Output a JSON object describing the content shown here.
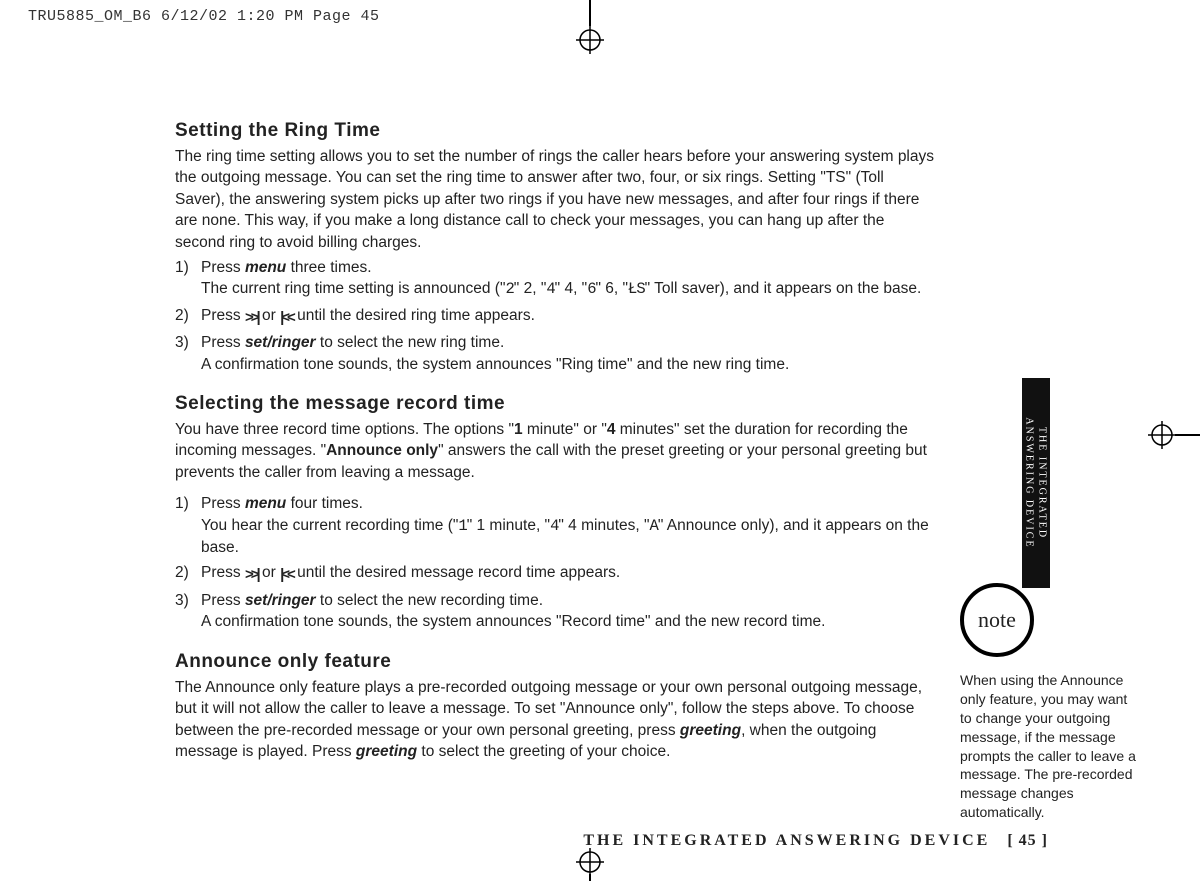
{
  "print_header": "TRU5885_OM_B6  6/12/02  1:20 PM  Page 45",
  "side_tab": "THE INTEGRATED\nANSWERING DEVICE",
  "footer_title": "THE INTEGRATED ANSWERING DEVICE",
  "footer_page": "[ 45 ]",
  "note_label": "note",
  "note_text": "When using the Announce only feature, you may want to change your outgoing message, if the message prompts the caller to leave a message. The pre-recorded message changes automatically.",
  "sections": {
    "ring": {
      "title": "Setting the Ring Time",
      "intro": "The ring time setting allows you to set the number of rings the caller hears before your answering system plays the outgoing message. You can set the ring time to answer after two, four, or six rings. Setting \"TS\" (Toll Saver), the answering system picks up after two rings if you have new messages, and after four rings if there are none. This way, if you make a long distance call to check your messages, you can hang up after the second ring to avoid billing charges.",
      "s1a": "Press ",
      "s1b": " three times.",
      "s1c_pre": "The current ring time setting is announced (\"",
      "s1c_v2": "\" 2, \"",
      "s1c_v4": "\" 4, \"",
      "s1c_v6": "\" 6, \"",
      "s1c_post": "\" Toll saver), and it appears on the base.",
      "s2a": "Press ",
      "s2b": " or ",
      "s2c": " until the desired ring time appears.",
      "s3a": "Press ",
      "s3b": " to select the new ring time.",
      "s3c": "A confirmation tone sounds, the system announces \"Ring time\" and the new ring time."
    },
    "record": {
      "title": "Selecting the message record time",
      "intro_a": "You have three record time options. The options \"",
      "intro_b": " minute\" or \"",
      "intro_c": " minutes\" set the duration for recording the incoming messages. \"",
      "intro_d": "\" answers the call with the preset greeting or your personal greeting but prevents the caller from leaving a message.",
      "opt1": "1",
      "opt4": "4",
      "optA": "Announce only",
      "s1a": "Press ",
      "s1b": " four times.",
      "s1c_pre": "You hear the current recording time (\"",
      "s1c_1": "\" 1 minute, \"",
      "s1c_4": "\" 4 minutes, \"",
      "s1c_post": "\" Announce only), and it appears on the base.",
      "s2a": "Press ",
      "s2b": " or ",
      "s2c": " until the desired message record time appears.",
      "s3a": "Press ",
      "s3b": " to select the new recording time.",
      "s3c": "A confirmation tone sounds, the system announces \"Record time\" and the new record time."
    },
    "announce": {
      "title": "Announce only feature",
      "p_a": "The Announce only feature plays a pre-recorded outgoing message or your own personal outgoing message, but it will not allow the caller to leave a message. To set \"Announce only\", follow the steps above. To choose between the pre-recorded message or your own personal greeting, press ",
      "p_b": ", when the outgoing message is played. Press ",
      "p_c": " to select the greeting of your choice."
    }
  },
  "kw": {
    "menu": "menu",
    "set_ringer": "set/ringer",
    "greeting": "greeting"
  },
  "seg": {
    "d2": "2",
    "d4": "4",
    "d6": "6",
    "ts": "ŁS",
    "d1": "1",
    "dA": "A"
  },
  "icons": {
    "ff": ">>|",
    "rw": "|<<"
  }
}
